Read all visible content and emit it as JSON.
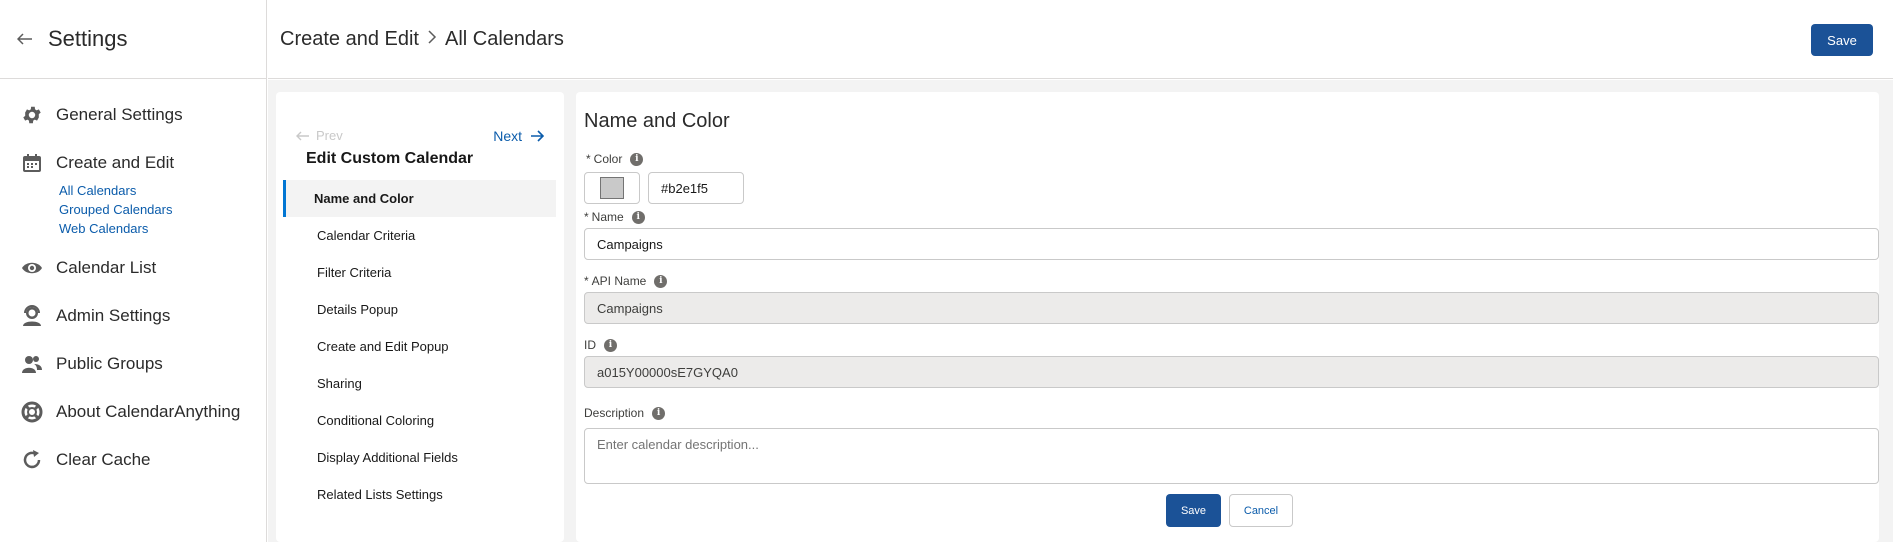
{
  "sidebar": {
    "title": "Settings",
    "items": [
      {
        "label": "General Settings",
        "icon": "gear-icon"
      },
      {
        "label": "Create and Edit",
        "icon": "calendar-icon"
      },
      {
        "label": "Calendar List",
        "icon": "eye-icon"
      },
      {
        "label": "Admin Settings",
        "icon": "admin-user-icon"
      },
      {
        "label": "Public Groups",
        "icon": "groups-icon"
      },
      {
        "label": "About CalendarAnything",
        "icon": "lifebuoy-icon"
      },
      {
        "label": "Clear Cache",
        "icon": "refresh-icon"
      }
    ],
    "sub_items": [
      "All Calendars",
      "Grouped Calendars",
      "Web Calendars"
    ]
  },
  "header": {
    "breadcrumb": [
      "Create and Edit",
      "All Calendars"
    ],
    "save_label": "Save"
  },
  "wizard": {
    "prev_label": "Prev",
    "next_label": "Next",
    "title": "Edit Custom Calendar",
    "steps": [
      "Name and Color",
      "Calendar Criteria",
      "Filter Criteria",
      "Details Popup",
      "Create and Edit Popup",
      "Sharing",
      "Conditional Coloring",
      "Display Additional Fields",
      "Related Lists Settings"
    ],
    "active_step": "Name and Color"
  },
  "form": {
    "title": "Name and Color",
    "color_label": "Color",
    "color_value": "#b2e1f5",
    "swatch_color": "#c9c9c9",
    "name_label": "Name",
    "name_value": "Campaigns",
    "api_name_label": "API Name",
    "api_name_value": "Campaigns",
    "id_label": "ID",
    "id_value": "a015Y00000sE7GYQA0",
    "description_label": "Description",
    "description_placeholder": "Enter calendar description...",
    "save_label": "Save",
    "cancel_label": "Cancel",
    "required_marker": "*",
    "info_glyph": "i"
  },
  "colors": {
    "brand": "#1b5297",
    "link": "#0b5cab",
    "active_step_border": "#0176d3"
  }
}
